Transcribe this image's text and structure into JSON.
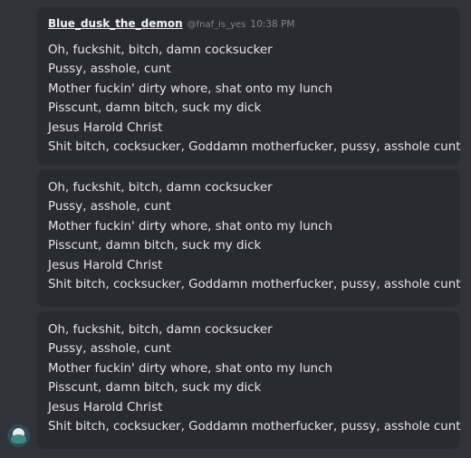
{
  "messages": [
    {
      "username": "Blue_dusk_the_demon",
      "handle": "@fnaf_is_yes",
      "timestamp": "10:38 PM",
      "lines": [
        "Oh, fuckshit, bitch, damn cocksucker",
        "Pussy, asshole, cunt",
        "Mother fuckin' dirty whore, shat onto my lunch",
        "Pisscunt, damn bitch, suck my dick",
        "Jesus Harold Christ",
        "Shit bitch, cocksucker, Goddamn motherfucker, pussy, asshole cunt"
      ]
    },
    {
      "lines": [
        "Oh, fuckshit, bitch, damn cocksucker",
        "Pussy, asshole, cunt",
        "Mother fuckin' dirty whore, shat onto my lunch",
        "Pisscunt, damn bitch, suck my dick",
        "Jesus Harold Christ",
        "Shit bitch, cocksucker, Goddamn motherfucker, pussy, asshole cunt"
      ]
    },
    {
      "lines": [
        "Oh, fuckshit, bitch, damn cocksucker",
        "Pussy, asshole, cunt",
        "Mother fuckin' dirty whore, shat onto my lunch",
        "Pisscunt, damn bitch, suck my dick",
        "Jesus Harold Christ",
        "Shit bitch, cocksucker, Goddamn motherfucker, pussy, asshole cunt"
      ]
    }
  ],
  "colors": {
    "background": "#323339",
    "message_bubble": "#2a2a31",
    "text": "#e4e4e8",
    "muted": "#80838c"
  },
  "avatar": {
    "icon": "user-avatar-icon"
  }
}
